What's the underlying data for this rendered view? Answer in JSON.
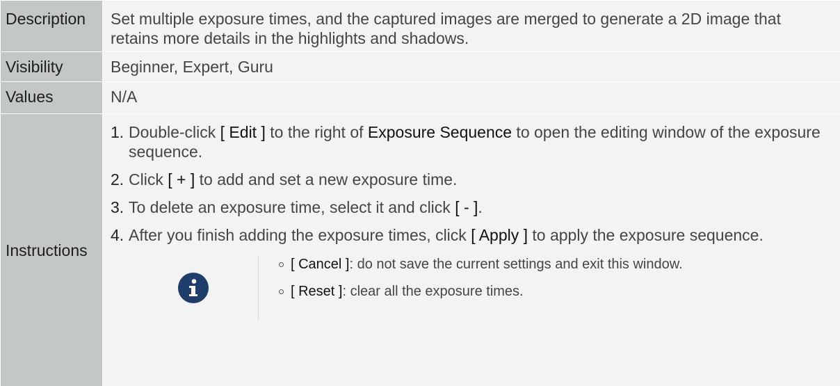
{
  "rows": {
    "description": {
      "label": "Description",
      "text": "Set multiple exposure times, and the captured images are merged to generate a 2D image that retains more details in the highlights and shadows."
    },
    "visibility": {
      "label": "Visibility",
      "text": "Beginner, Expert, Guru"
    },
    "values": {
      "label": "Values",
      "text": "N/A"
    },
    "instructions": {
      "label": "Instructions",
      "steps": [
        {
          "num": "1.",
          "a": "Double-click ",
          "ui1": "[ Edit ]",
          "b": " to the right of ",
          "ui2": "Exposure Sequence",
          "c": " to open the editing window of the exposure sequence."
        },
        {
          "num": "2.",
          "a": "Click ",
          "ui1": "[ + ]",
          "b": " to add and set a new exposure time."
        },
        {
          "num": "3.",
          "a": "To delete an exposure time, select it and click ",
          "ui1": "[ - ]",
          "b": "."
        },
        {
          "num": "4.",
          "a": "After you finish adding the exposure times, click ",
          "ui1": "[ Apply ]",
          "b": " to apply the exposure sequence."
        }
      ],
      "note": {
        "icon": "info-icon",
        "items": [
          {
            "ui": "[ Cancel ]",
            "text": ": do not save the current settings and exit this window."
          },
          {
            "ui": "[ Reset ]",
            "text": ": clear all the exposure times."
          }
        ]
      }
    }
  },
  "colors": {
    "label_bg": "#c3c7c5",
    "value_bg": "#f3f3f3",
    "icon_bg": "#1f3d6b"
  }
}
